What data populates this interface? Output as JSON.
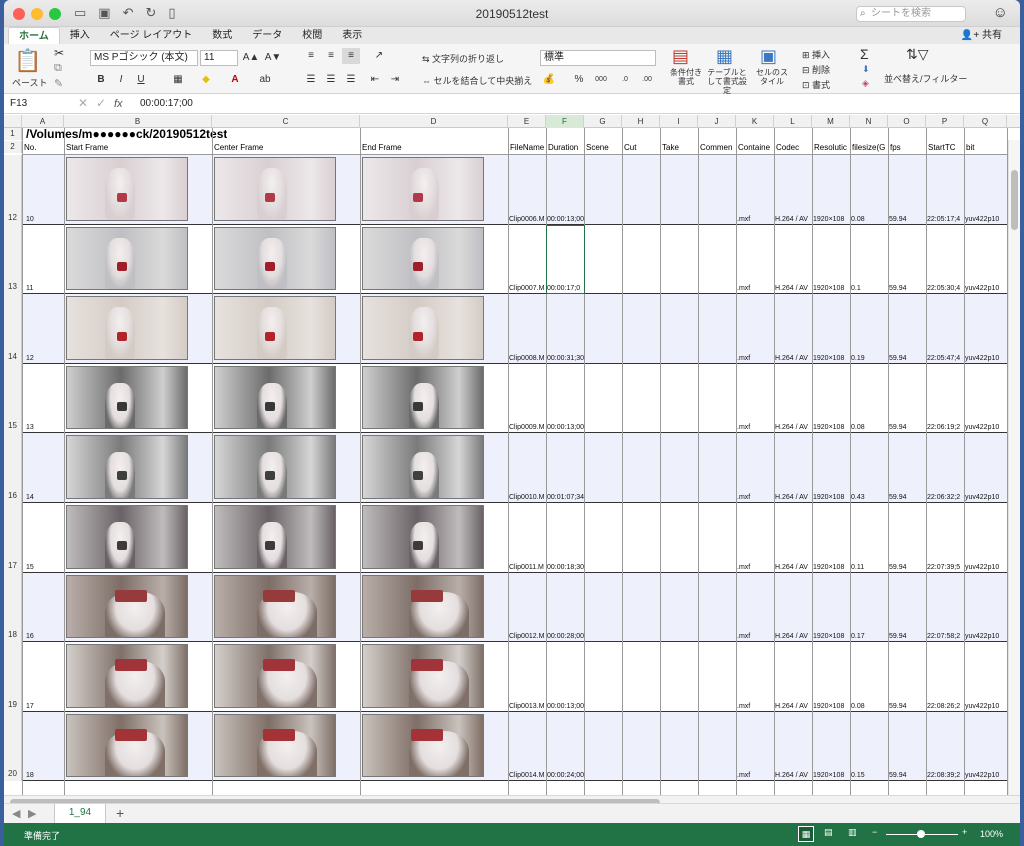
{
  "window": {
    "title": "20190512test"
  },
  "search": {
    "placeholder": "シートを検索"
  },
  "tabs": [
    "ホーム",
    "挿入",
    "ページ レイアウト",
    "数式",
    "データ",
    "校閲",
    "表示"
  ],
  "share_label": "共有",
  "ribbon": {
    "paste_label": "ペースト",
    "font_name": "MS Pゴシック (本文)",
    "font_size": "11",
    "bold": "B",
    "italic": "I",
    "underline": "U",
    "wrap_text": "文字列の折り返し",
    "merge_center": "セルを結合して中央揃え",
    "number_format": "標準",
    "conditional_format": "条件付き書式",
    "table_format": "テーブルとして書式設定",
    "cell_styles": "セルのスタイル",
    "insert": "挿入",
    "delete": "削除",
    "format": "書式",
    "sort_filter": "並べ替え/フィルター"
  },
  "formula_bar": {
    "name_box": "F13",
    "fx": "fx",
    "content": "00:00:17;00"
  },
  "columns": [
    "A",
    "B",
    "C",
    "D",
    "E",
    "F",
    "G",
    "H",
    "I",
    "J",
    "K",
    "L",
    "M",
    "N",
    "O",
    "P",
    "Q"
  ],
  "sheet": {
    "title_row_label": "1",
    "title": "/Volumes/m●●●●●●ck/20190512test",
    "header_row_label": "2",
    "headers": [
      "No.",
      "Start Frame",
      "Center Frame",
      "End Frame",
      "FileName",
      "Duration",
      "Scene",
      "Cut",
      "Take",
      "Commen",
      "Containe",
      "Codec",
      "Resolutic",
      "filesize(G",
      "fps",
      "StartTC",
      "bit"
    ],
    "rows": [
      {
        "r": "12",
        "no": "10",
        "file": "Clip0006.M",
        "dur": "00:00:13;00",
        "cont": ".mxf",
        "codec": "H.264 / AV",
        "res": "1920×108",
        "size": "0.08",
        "fps": "59.94",
        "tc": "22:05:17;4",
        "bit": "yuv422p10"
      },
      {
        "r": "13",
        "no": "11",
        "file": "Clip0007.M",
        "dur": "00:00:17;0",
        "cont": ".mxf",
        "codec": "H.264 / AV",
        "res": "1920×108",
        "size": "0.1",
        "fps": "59.94",
        "tc": "22:05:30;4",
        "bit": "yuv422p10"
      },
      {
        "r": "14",
        "no": "12",
        "file": "Clip0008.M",
        "dur": "00:00:31;30",
        "cont": ".mxf",
        "codec": "H.264 / AV",
        "res": "1920×108",
        "size": "0.19",
        "fps": "59.94",
        "tc": "22:05:47;4",
        "bit": "yuv422p10"
      },
      {
        "r": "15",
        "no": "13",
        "file": "Clip0009.M",
        "dur": "00:00:13;00",
        "cont": ".mxf",
        "codec": "H.264 / AV",
        "res": "1920×108",
        "size": "0.08",
        "fps": "59.94",
        "tc": "22:06:19;2",
        "bit": "yuv422p10"
      },
      {
        "r": "16",
        "no": "14",
        "file": "Clip0010.M",
        "dur": "00:01:07;34",
        "cont": ".mxf",
        "codec": "H.264 / AV",
        "res": "1920×108",
        "size": "0.43",
        "fps": "59.94",
        "tc": "22:06:32;2",
        "bit": "yuv422p10"
      },
      {
        "r": "17",
        "no": "15",
        "file": "Clip0011.M",
        "dur": "00:00:18;30",
        "cont": ".mxf",
        "codec": "H.264 / AV",
        "res": "1920×108",
        "size": "0.11",
        "fps": "59.94",
        "tc": "22:07:39;5",
        "bit": "yuv422p10"
      },
      {
        "r": "18",
        "no": "16",
        "file": "Clip0012.M",
        "dur": "00:00:28;00",
        "cont": ".mxf",
        "codec": "H.264 / AV",
        "res": "1920×108",
        "size": "0.17",
        "fps": "59.94",
        "tc": "22:07:58;2",
        "bit": "yuv422p10"
      },
      {
        "r": "19",
        "no": "17",
        "file": "Clip0013.M",
        "dur": "00:00:13;00",
        "cont": ".mxf",
        "codec": "H.264 / AV",
        "res": "1920×108",
        "size": "0.08",
        "fps": "59.94",
        "tc": "22:08:26;2",
        "bit": "yuv422p10"
      },
      {
        "r": "20",
        "no": "18",
        "file": "Clip0014.M",
        "dur": "00:00:24;00",
        "cont": ".mxf",
        "codec": "H.264 / AV",
        "res": "1920×108",
        "size": "0.15",
        "fps": "59.94",
        "tc": "22:08:39;2",
        "bit": "yuv422p10"
      }
    ]
  },
  "sheet_tab": "1_94",
  "status": {
    "ready": "準備完了",
    "zoom": "100%"
  },
  "colors": {
    "accent": "#217346",
    "row_shade": "#eef1fb"
  }
}
